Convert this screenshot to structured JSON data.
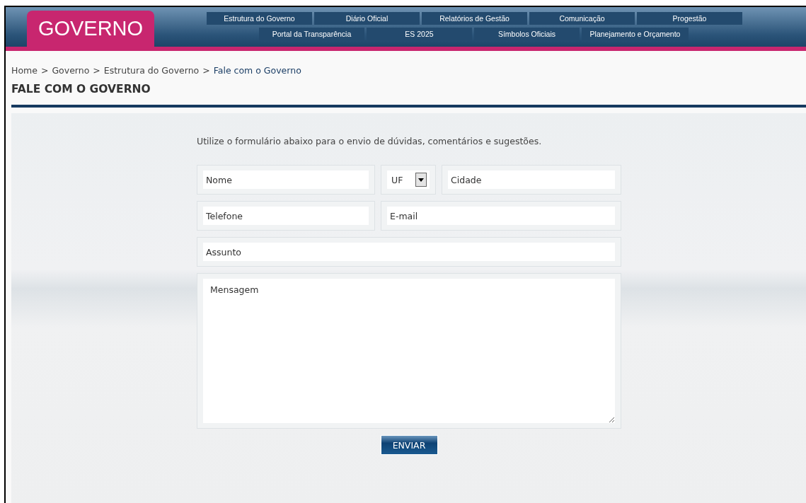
{
  "header": {
    "logo": "GOVERNO",
    "nav_rows": [
      [
        "Estrutura do Governo",
        "Diário Oficial",
        "Relatórios de Gestão",
        "Comunicação",
        "Progestão"
      ],
      [
        "Portal da Transparência",
        "ES 2025",
        "Símbolos Oficiais",
        "Planejamento e Orçamento"
      ]
    ]
  },
  "breadcrumb": [
    {
      "label": "Home",
      "separator": ">",
      "current": false
    },
    {
      "label": "Governo",
      "separator": ">",
      "current": false
    },
    {
      "label": "Estrutura do Governo",
      "separator": ">",
      "current": false
    },
    {
      "label": "Fale com o Governo",
      "current": true
    }
  ],
  "page_title": "FALE COM O GOVERNO",
  "form": {
    "intro": "Utilize o formulário abaixo para o envio de dúvidas, comentários e sugestões.",
    "rows": [
      [
        {
          "kind": "input",
          "placeholder": "Nome"
        },
        {
          "kind": "select",
          "value": "UF"
        },
        {
          "kind": "input",
          "placeholder": "Cidade"
        }
      ],
      [
        {
          "kind": "input",
          "placeholder": "Telefone"
        },
        {
          "kind": "input",
          "placeholder": "E-mail"
        }
      ],
      [
        {
          "kind": "input",
          "placeholder": "Assunto"
        }
      ],
      [
        {
          "kind": "textarea",
          "placeholder": "Mensagem"
        }
      ]
    ],
    "submit": "ENVIAR"
  }
}
